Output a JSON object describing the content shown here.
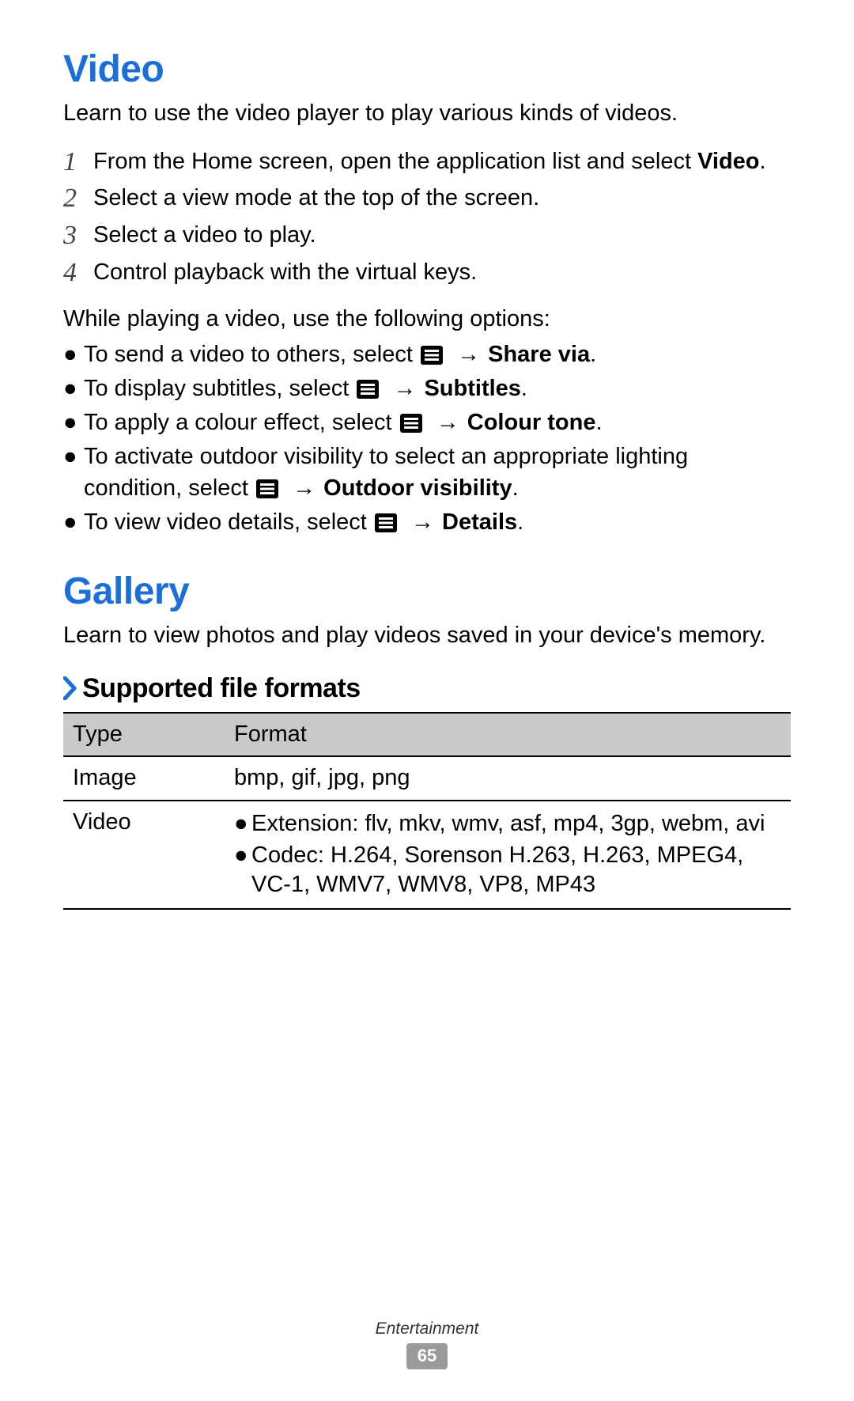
{
  "video": {
    "heading": "Video",
    "intro": "Learn to use the video player to play various kinds of videos.",
    "steps": [
      {
        "num": "1",
        "pre": "From the Home screen, open the application list and select ",
        "bold": "Video",
        "post": "."
      },
      {
        "num": "2",
        "pre": "Select a view mode at the top of the screen.",
        "bold": "",
        "post": ""
      },
      {
        "num": "3",
        "pre": "Select a video to play.",
        "bold": "",
        "post": ""
      },
      {
        "num": "4",
        "pre": "Control playback with the virtual keys.",
        "bold": "",
        "post": ""
      }
    ],
    "sub_lead": "While playing a video, use the following options:",
    "options": [
      {
        "pre": "To send a video to others, select ",
        "post_bold": "Share via",
        "tail": "."
      },
      {
        "pre": "To display subtitles, select ",
        "post_bold": "Subtitles",
        "tail": "."
      },
      {
        "pre": "To apply a colour effect, select ",
        "post_bold": "Colour tone",
        "tail": "."
      },
      {
        "pre": "To activate outdoor visibility to select an appropriate lighting condition, select ",
        "post_bold": "Outdoor visibility",
        "tail": "."
      },
      {
        "pre": "To view video details, select ",
        "post_bold": "Details",
        "tail": "."
      }
    ],
    "arrow": "→"
  },
  "gallery": {
    "heading": "Gallery",
    "intro": "Learn to view photos and play videos saved in your device's memory.",
    "subheading": "Supported file formats",
    "table": {
      "headers": {
        "type": "Type",
        "format": "Format"
      },
      "rows": [
        {
          "type": "Image",
          "format_plain": "bmp, gif, jpg, png"
        },
        {
          "type": "Video",
          "format_bullets": [
            "Extension: flv, mkv, wmv, asf, mp4, 3gp, webm, avi",
            "Codec: H.264, Sorenson H.263, H.263, MPEG4, VC-1, WMV7, WMV8, VP8, MP43"
          ]
        }
      ]
    }
  },
  "footer": {
    "category": "Entertainment",
    "page": "65"
  },
  "bullet_char": "●"
}
